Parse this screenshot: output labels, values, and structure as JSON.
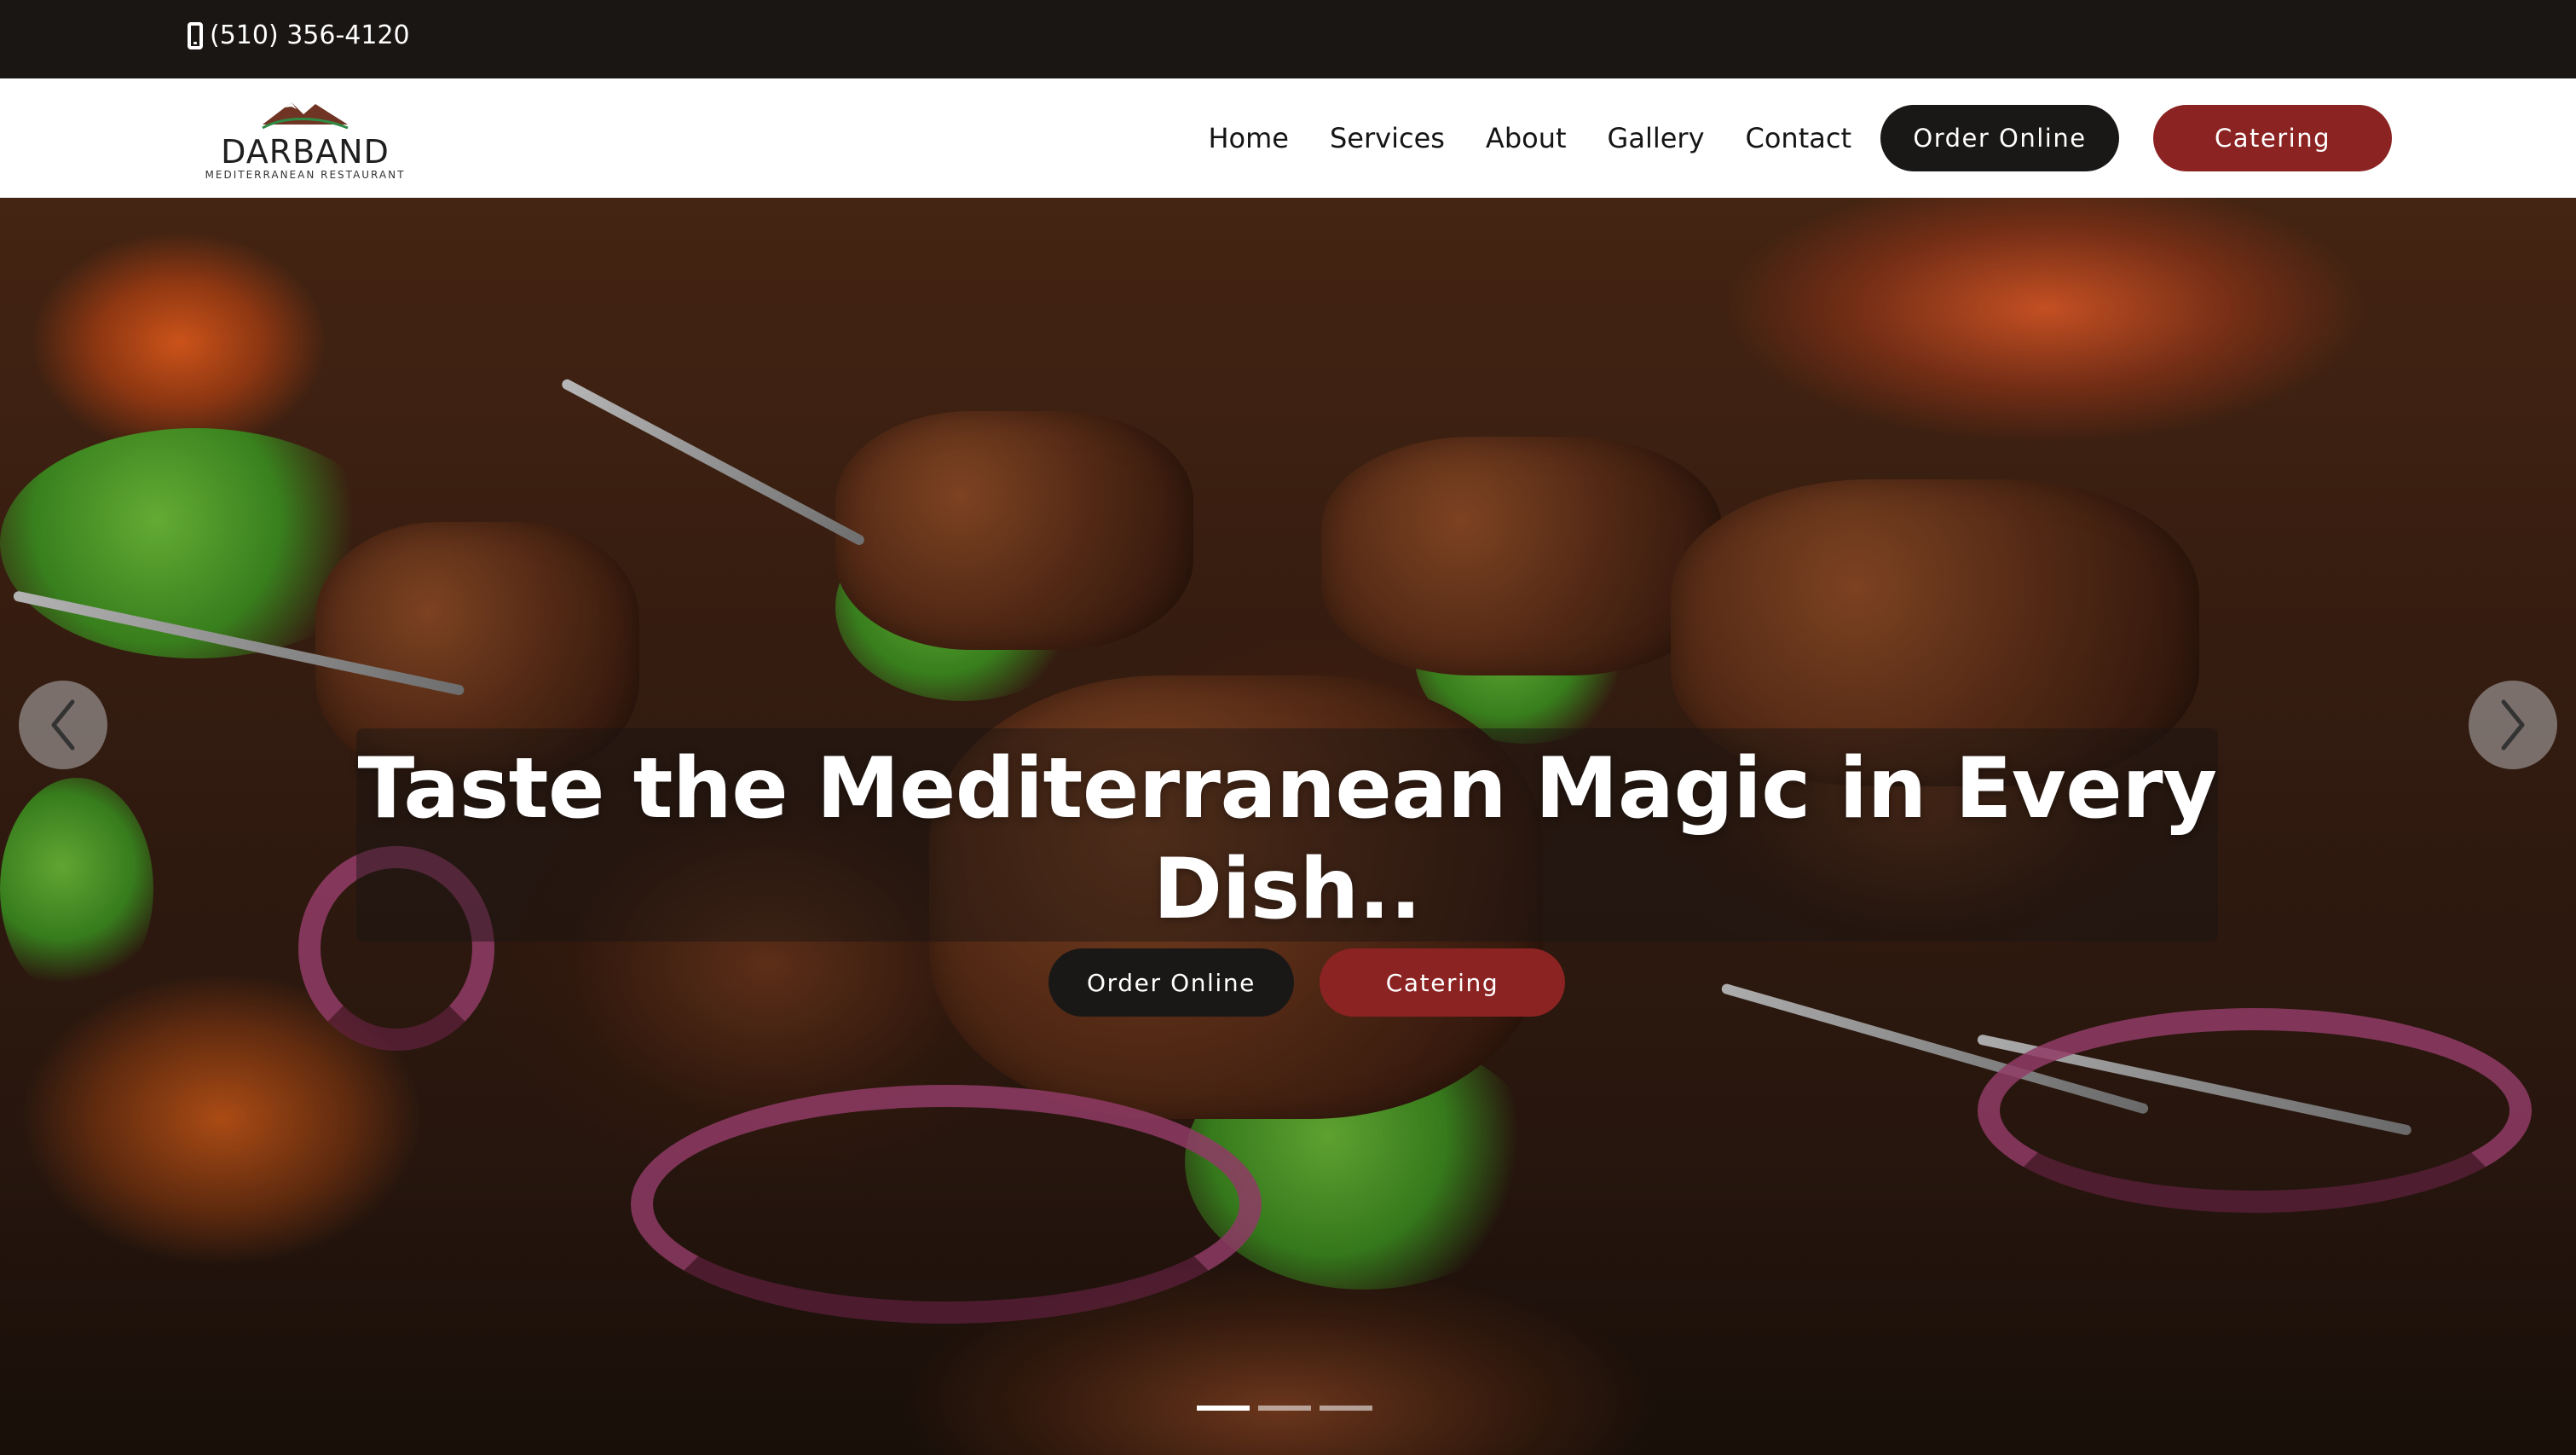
{
  "topbar": {
    "phone": "(510) 356-4120",
    "phone_icon": "mobile-phone-icon"
  },
  "navbar": {
    "logo_name": "DARBAND",
    "logo_tag": "MEDITERRANEAN RESTAURANT",
    "links": [
      "Home",
      "Services",
      "About",
      "Gallery",
      "Contact"
    ],
    "order_online": "Order Online",
    "catering": "Catering"
  },
  "hero": {
    "headline": "Taste the Mediterranean Magic in Every Dish..",
    "order_online": "Order Online",
    "catering": "Catering",
    "arrow_left_icon": "chevron-left-icon",
    "arrow_right_icon": "chevron-right-icon"
  },
  "carousel": {
    "active_index": 0,
    "slides": 3
  },
  "colors": {
    "brand_dark": "#1a1817",
    "brand_red": "#8b2322",
    "text_dark": "#151515"
  }
}
